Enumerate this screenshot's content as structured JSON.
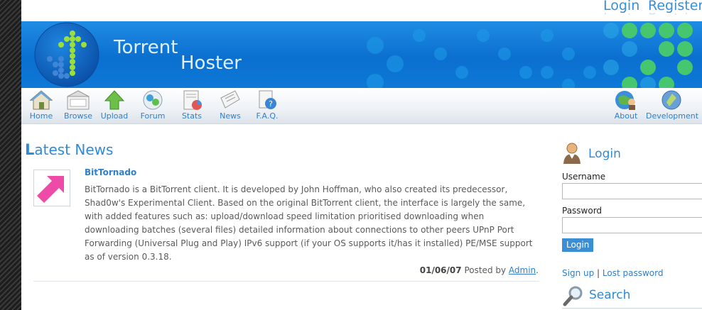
{
  "header": {
    "login_link": "Login",
    "register_link": "Register",
    "site_title_line1": "Torrent",
    "site_title_line2": "Hoster"
  },
  "nav": {
    "items": [
      {
        "label": "Home",
        "icon": "home-icon"
      },
      {
        "label": "Browse",
        "icon": "browse-icon"
      },
      {
        "label": "Upload",
        "icon": "upload-icon"
      },
      {
        "label": "Forum",
        "icon": "forum-icon"
      },
      {
        "label": "Stats",
        "icon": "stats-icon"
      },
      {
        "label": "News",
        "icon": "news-icon"
      },
      {
        "label": "F.A.Q.",
        "icon": "faq-icon"
      }
    ],
    "right_items": [
      {
        "label": "About",
        "icon": "about-icon"
      },
      {
        "label": "Development",
        "icon": "development-icon"
      }
    ]
  },
  "main": {
    "heading_first": "L",
    "heading_rest": "atest News",
    "news": {
      "title": "BitTornado",
      "body": "BitTornado is a BitTorrent client. It is developed by John Hoffman, who also created its predecessor, Shad0w's Experimental Client. Based on the original BitTorrent client, the interface is largely the same, with added features such as: upload/download speed limitation prioritised downloading when downloading batches (several files) detailed information about connections to other peers UPnP Port Forwarding (Universal Plug and Play) IPv6 support (if your OS supports it/has it installed) PE/MSE support as of version 0.3.18.",
      "date": "01/06/07",
      "posted_by": "Posted by",
      "author": "Admin",
      "trailing": "."
    }
  },
  "sidebar": {
    "login_heading": "Login",
    "username_label": "Username",
    "password_label": "Password",
    "username_value": "",
    "password_value": "",
    "login_button": "Login",
    "signup_link": "Sign up",
    "separator": "|",
    "lost_password_link": "Lost password",
    "search_heading": "Search"
  },
  "colors": {
    "accent": "#2f8ad8",
    "banner": "#0b6fd0",
    "dot_green": "#3fbf5a"
  }
}
